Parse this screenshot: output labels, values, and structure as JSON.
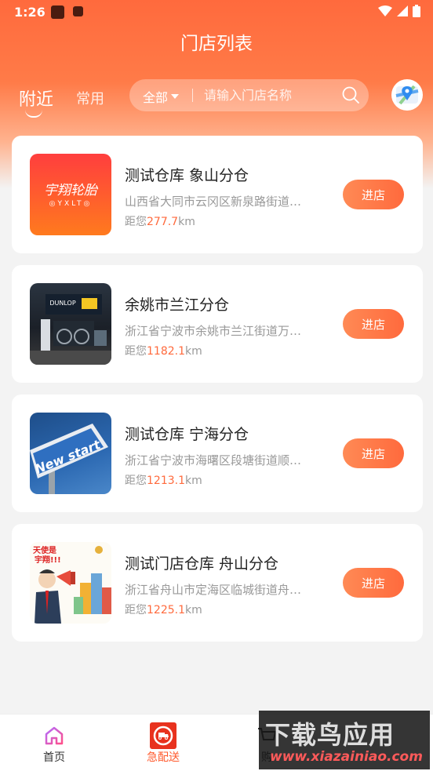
{
  "status_bar": {
    "time": "1:26"
  },
  "header": {
    "title": "门店列表"
  },
  "tabs": [
    {
      "label": "附近",
      "active": true
    },
    {
      "label": "常用",
      "active": false
    }
  ],
  "search": {
    "filter_label": "全部",
    "placeholder": "请输入门店名称"
  },
  "stores": [
    {
      "name": "测试仓库 象山分仓",
      "address": "山西省大同市云冈区新泉路街道…",
      "distance_prefix": "距您",
      "distance": "277.7",
      "unit": "km",
      "button": "进店",
      "logo_text": "宇翔轮胎",
      "logo_sub": "YXLT"
    },
    {
      "name": "余姚市兰江分仓",
      "address": "浙江省宁波市余姚市兰江街道万…",
      "distance_prefix": "距您",
      "distance": "1182.1",
      "unit": "km",
      "button": "进店",
      "logo_text": "DUNLOP"
    },
    {
      "name": "测试仓库 宁海分仓",
      "address": "浙江省宁波市海曙区段塘街道顺…",
      "distance_prefix": "距您",
      "distance": "1213.1",
      "unit": "km",
      "button": "进店",
      "logo_text": "New start"
    },
    {
      "name": "测试门店仓库 舟山分仓",
      "address": "浙江省舟山市定海区临城街道舟…",
      "distance_prefix": "距您",
      "distance": "1225.1",
      "unit": "km",
      "button": "进店",
      "logo_text": "天使是 宇翔!!!"
    }
  ],
  "bottom_nav": [
    {
      "label": "首页",
      "icon": "home-icon"
    },
    {
      "label": "急配送",
      "icon": "delivery-truck-icon"
    },
    {
      "label": "购",
      "icon": "cart-icon"
    }
  ],
  "watermark": {
    "title": "下载鸟应用",
    "url": "www.xiazainiao.com"
  },
  "colors": {
    "accent": "#ff6a3d",
    "watermark_url": "#ff5a5a"
  }
}
